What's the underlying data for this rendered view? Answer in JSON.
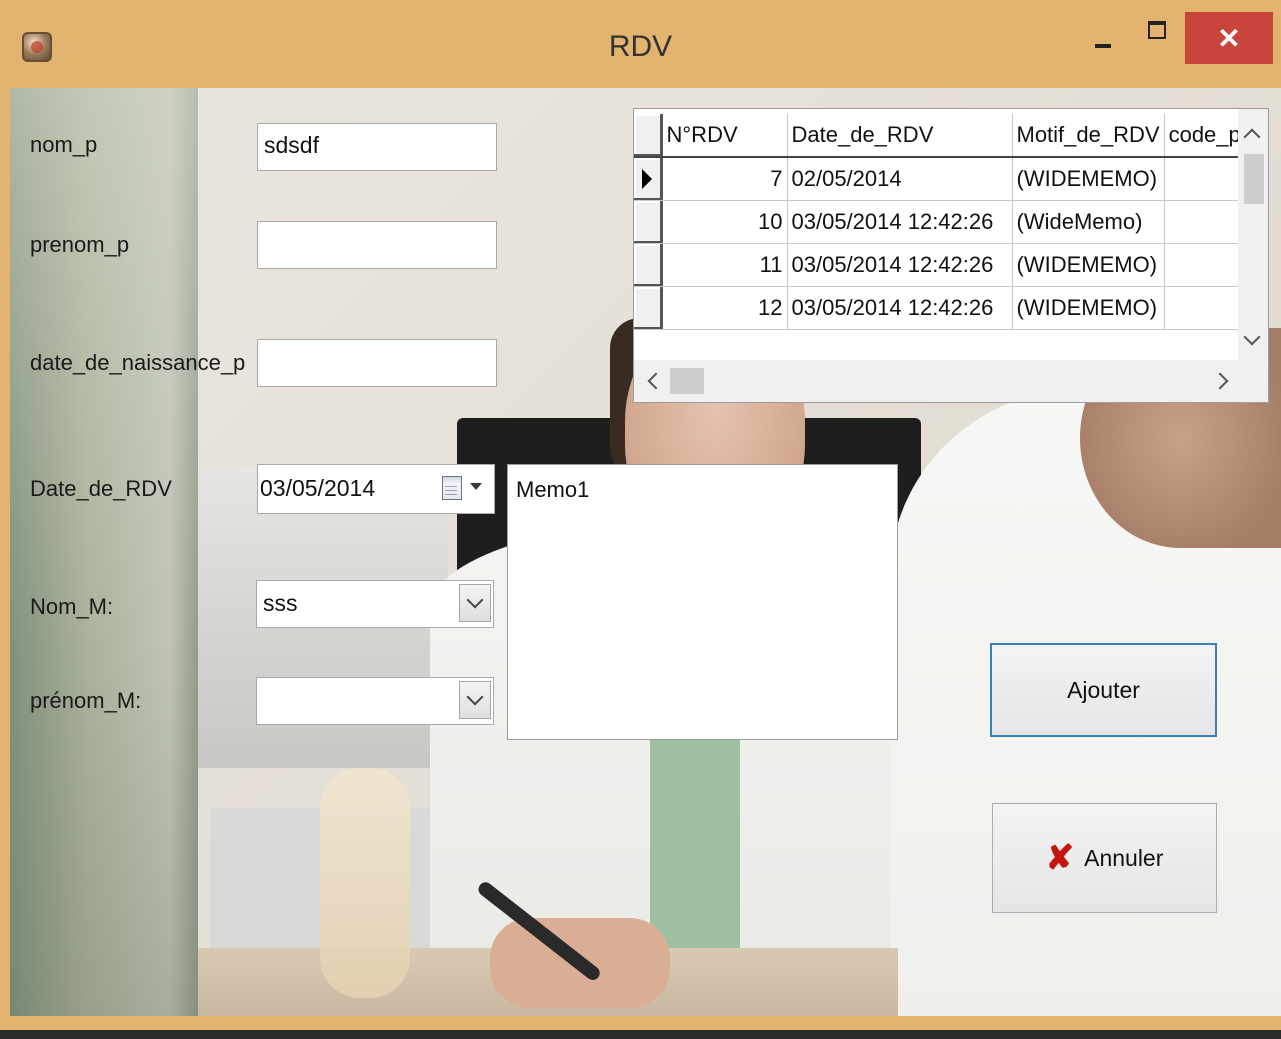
{
  "window": {
    "title": "RDV",
    "minimize_label": "",
    "maximize_label": "",
    "close_label": "✕"
  },
  "form": {
    "nom_p": {
      "label": "nom_p",
      "value": "sdsdf"
    },
    "prenom_p": {
      "label": "prenom_p",
      "value": ""
    },
    "date_de_naissance_p": {
      "label": "date_de_naissance_p",
      "value": ""
    },
    "date_de_rdv": {
      "label": "Date_de_RDV",
      "value": "03/05/2014"
    },
    "nom_m": {
      "label": "Nom_M:",
      "value": "sss"
    },
    "prenom_m": {
      "label": "prénom_M:",
      "value": ""
    },
    "memo": {
      "value": "Memo1"
    }
  },
  "buttons": {
    "ajouter": "Ajouter",
    "annuler": "Annuler",
    "annuler_icon": "✘"
  },
  "grid": {
    "columns": [
      "N°RDV",
      "Date_de_RDV",
      "Motif_de_RDV",
      "code_p"
    ],
    "rows": [
      [
        "7",
        "02/05/2014",
        "(WIDEMEMO)",
        ""
      ],
      [
        "10",
        "03/05/2014 12:42:26",
        "(WideMemo)",
        ""
      ],
      [
        "11",
        "03/05/2014 12:42:26",
        "(WIDEMEMO)",
        ""
      ],
      [
        "12",
        "03/05/2014 12:42:26",
        "(WIDEMEMO)",
        ""
      ]
    ]
  },
  "colors": {
    "titlebar": "#e3b46f",
    "close_button": "#c9453c",
    "ajouter_border": "#3c7fb1",
    "annuler_icon": "#c4160e"
  }
}
